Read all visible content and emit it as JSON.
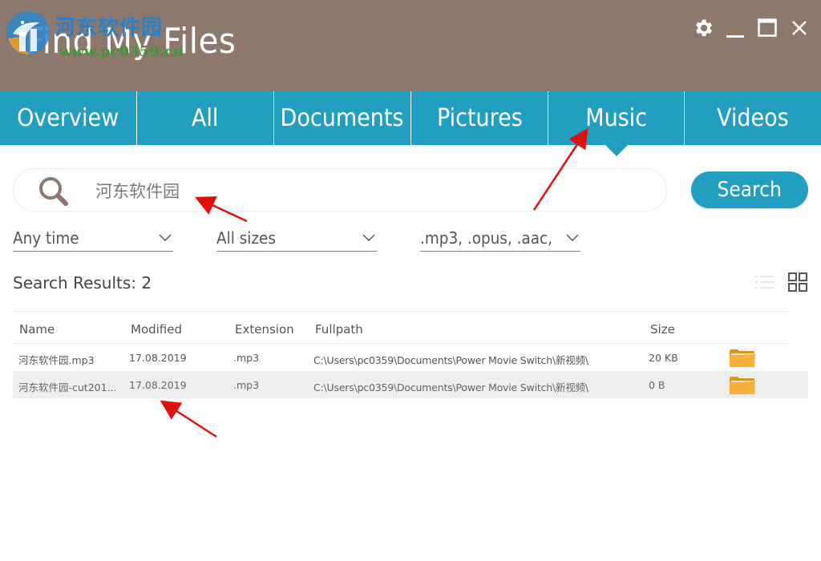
{
  "window": {
    "title": "Find My Files",
    "watermark_text": "河东软件园",
    "watermark_url": "www.pc0359.cn",
    "controls": [
      {
        "name": "settings",
        "icon": "gear-icon"
      },
      {
        "name": "minimize",
        "icon": "minimize-icon"
      },
      {
        "name": "maximize",
        "icon": "maximize-icon"
      },
      {
        "name": "close",
        "icon": "close-icon"
      }
    ]
  },
  "tabs": [
    {
      "label": "Overview",
      "active": false
    },
    {
      "label": "All",
      "active": false
    },
    {
      "label": "Documents",
      "active": false
    },
    {
      "label": "Pictures",
      "active": false
    },
    {
      "label": "Music",
      "active": true
    },
    {
      "label": "Videos",
      "active": false
    }
  ],
  "search": {
    "value": "河东软件园",
    "icon": "search-icon",
    "button_label": "Search"
  },
  "filters": {
    "time": "Any time",
    "size": "All sizes",
    "extensions": ".mp3, .opus, .aac,"
  },
  "results": {
    "title": "Search Results:",
    "count": "2",
    "view_modes": [
      "list-view-icon",
      "grid-view-icon"
    ],
    "columns": {
      "name": "Name",
      "modified": "Modified",
      "extension": "Extension",
      "fullpath": "Fullpath",
      "size": "Size"
    },
    "rows": [
      {
        "name": "河东软件园.mp3",
        "modified": "17.08.2019",
        "extension": ".mp3",
        "fullpath": "C:\\Users\\pc0359\\Documents\\Power Movie Switch\\新视频\\",
        "size": "20 KB"
      },
      {
        "name": "河东软件园-cut201...",
        "modified": "17.08.2019",
        "extension": ".mp3",
        "fullpath": "C:\\Users\\pc0359\\Documents\\Power Movie Switch\\新视频\\",
        "size": "0 B"
      }
    ]
  },
  "colors": {
    "titlebar": "#8c786d",
    "accent": "#229fc0",
    "folder": "#f7b13b",
    "annotation_arrow": "#e01010"
  }
}
